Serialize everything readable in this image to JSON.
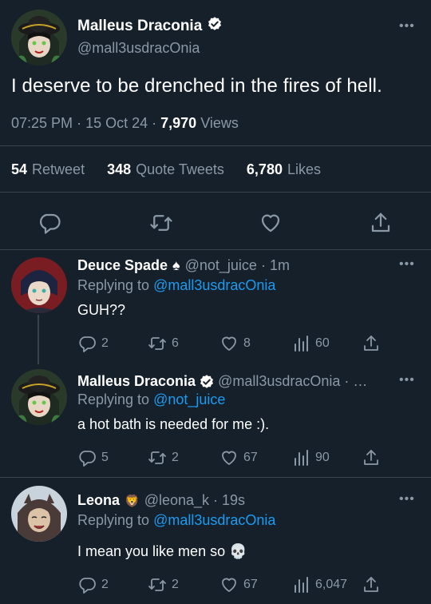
{
  "main_tweet": {
    "name": "Malleus Draconia",
    "handle": "@mall3usdracOnia",
    "text": "I deserve to be drenched in the fires of hell.",
    "time": "07:25 PM",
    "date": "15 Oct 24",
    "views_count": "7,970",
    "views_label": "Views",
    "retweets_count": "54",
    "retweets_label": "Retweet",
    "quotes_count": "348",
    "quotes_label": "Quote Tweets",
    "likes_count": "6,780",
    "likes_label": "Likes",
    "more_label": "•••"
  },
  "replies": [
    {
      "name": "Deuce Spade",
      "symbol": "♠",
      "handle": "@not_juice",
      "time": "1m",
      "replying_prefix": "Replying to",
      "replying_to": "@mall3usdracOnia",
      "text": "GUH??",
      "reply_count": "2",
      "retweet_count": "6",
      "like_count": "8",
      "view_count": "60",
      "more_label": "•••"
    },
    {
      "name": "Malleus Draconia",
      "handle": "@mall3usdracOnia",
      "time": "…",
      "replying_prefix": "Replying to",
      "replying_to": "@not_juice",
      "text": "a hot bath is needed for me :).",
      "reply_count": "5",
      "retweet_count": "2",
      "like_count": "67",
      "view_count": "90",
      "more_label": "•••"
    },
    {
      "name": "Leona",
      "symbol": "🦁",
      "handle": "@leona_k",
      "time": "19s",
      "replying_prefix": "Replying to",
      "replying_to": "@mall3usdracOnia",
      "text": "I mean you like men so",
      "emoji": "💀",
      "reply_count": "2",
      "retweet_count": "2",
      "like_count": "67",
      "view_count": "6,047",
      "more_label": "•••"
    }
  ],
  "colors": {
    "background": "#15202b",
    "muted": "#8b98a5",
    "link": "#1d9bf0",
    "divider": "#38444d"
  },
  "icons": [
    "verified-badge-icon",
    "reply-icon",
    "retweet-icon",
    "like-icon",
    "share-icon",
    "views-icon",
    "more-icon"
  ]
}
